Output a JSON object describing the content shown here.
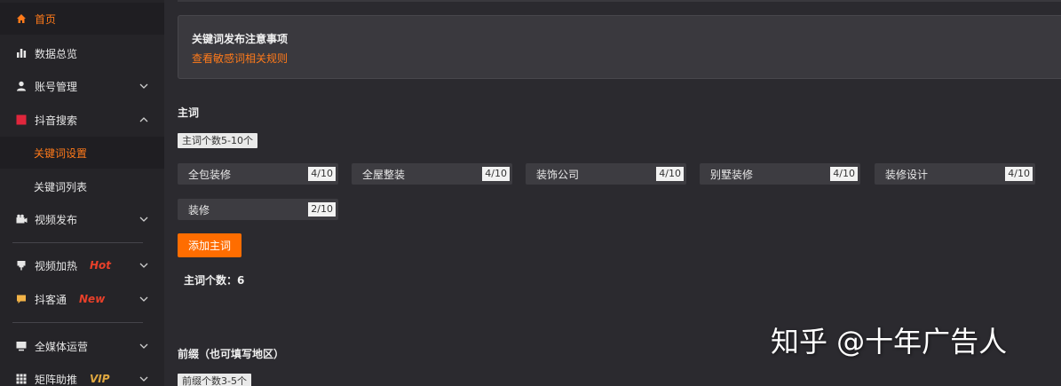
{
  "sidebar": {
    "items": [
      {
        "label": "首页",
        "icon": "home-icon"
      },
      {
        "label": "数据总览",
        "icon": "bar-chart-icon"
      },
      {
        "label": "账号管理",
        "icon": "user-icon"
      },
      {
        "label": "抖音搜索",
        "icon": "red-square-icon"
      },
      {
        "label": "视频发布",
        "icon": "video-camera-icon"
      },
      {
        "label": "视频加热",
        "icon": "push-pin-icon",
        "badge": "Hot"
      },
      {
        "label": "抖客通",
        "icon": "chat-icon",
        "badge": "New"
      },
      {
        "label": "全媒体运营",
        "icon": "monitor-icon"
      },
      {
        "label": "矩阵助推",
        "icon": "grid-icon",
        "badge": "VIP"
      }
    ],
    "sub_items": [
      "关键词设置",
      "关键词列表"
    ]
  },
  "notice": {
    "title": "关键词发布注意事项",
    "link": "查看敏感词相关规则"
  },
  "main_words": {
    "title": "主词",
    "hint": "主词个数5-10个",
    "keywords": [
      {
        "label": "全包装修",
        "count": "4/10"
      },
      {
        "label": "全屋整装",
        "count": "4/10"
      },
      {
        "label": "装饰公司",
        "count": "4/10"
      },
      {
        "label": "别墅装修",
        "count": "4/10"
      },
      {
        "label": "装修设计",
        "count": "4/10"
      },
      {
        "label": "装修",
        "count": "2/10"
      }
    ],
    "add_button": "添加主词",
    "count_text": "主词个数：6"
  },
  "prefix": {
    "title": "前缀（也可填写地区）",
    "hint": "前缀个数3-5个"
  },
  "watermark": "知乎 @十年广告人",
  "colors": {
    "accent": "#ff7a1a",
    "button": "#ff6d00",
    "hot": "#e8402a",
    "new": "#e8402a",
    "vip": "#e0a840"
  }
}
